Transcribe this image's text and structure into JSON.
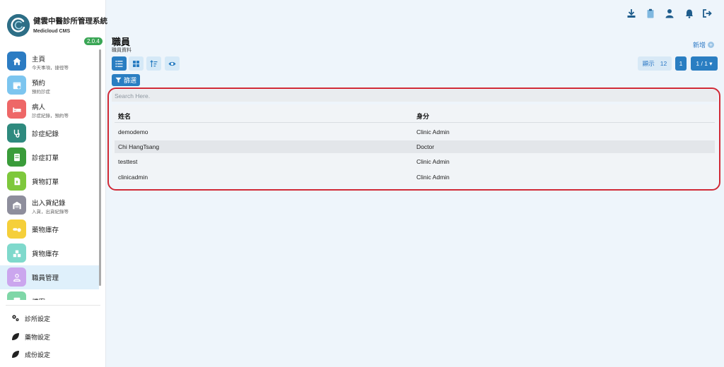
{
  "brand": {
    "title": "健雲中醫診所管理系統",
    "subtitle": "Medicloud CMS",
    "version": "2.0.4"
  },
  "nav": {
    "items": [
      {
        "label": "主頁",
        "sub": "今天事項，捷徑等",
        "color": "#2c7cc3",
        "icon": "home-icon"
      },
      {
        "label": "預約",
        "sub": "預約診症",
        "color": "#7cc5ef",
        "icon": "calendar-icon"
      },
      {
        "label": "病人",
        "sub": "診症紀錄，預約等",
        "color": "#ee6767",
        "icon": "bed-icon"
      },
      {
        "label": "診症紀錄",
        "sub": "",
        "color": "#2e8a7e",
        "icon": "stethoscope-icon"
      },
      {
        "label": "診症訂單",
        "sub": "",
        "color": "#3a9c3a",
        "icon": "order-icon"
      },
      {
        "label": "貨物訂單",
        "sub": "",
        "color": "#7ec83c",
        "icon": "document-icon"
      },
      {
        "label": "出入貨紀錄",
        "sub": "入貨，出貨紀錄等",
        "color": "#8e8e9c",
        "icon": "warehouse-icon"
      },
      {
        "label": "藥物庫存",
        "sub": "",
        "color": "#f5cf3a",
        "icon": "pills-icon"
      },
      {
        "label": "貨物庫存",
        "sub": "",
        "color": "#7fd9cc",
        "icon": "boxes-icon"
      },
      {
        "label": "職員管理",
        "sub": "",
        "color": "#cba6ee",
        "icon": "staff-icon"
      },
      {
        "label": "檔案",
        "sub": "",
        "color": "#7fd7a7",
        "icon": "file-icon"
      }
    ]
  },
  "settings": {
    "items": [
      {
        "label": "診所設定",
        "icon": "gears-icon"
      },
      {
        "label": "藥物設定",
        "icon": "leaf-icon"
      },
      {
        "label": "成份設定",
        "icon": "leaf-icon"
      }
    ]
  },
  "topbar": {
    "icons": [
      "download-icon",
      "clipboard-icon",
      "user-icon",
      "bell-icon",
      "logout-icon"
    ]
  },
  "page": {
    "title": "職員",
    "subtitle": "職員資料",
    "add_label": "新增",
    "add_plus": "+"
  },
  "toolbar": {
    "show_label": "顯示",
    "show_count": "12",
    "current_page": "1",
    "page_select": "1 / 1 ▾",
    "filter_label": "篩選"
  },
  "search": {
    "placeholder": "Search Here."
  },
  "table": {
    "columns": [
      "姓名",
      "身分"
    ],
    "rows": [
      [
        "demodemo",
        "Clinic Admin"
      ],
      [
        "Chi HangTsang",
        "Doctor"
      ],
      [
        "testtest",
        "Clinic Admin"
      ],
      [
        "clinicadmin",
        "Clinic Admin"
      ]
    ]
  },
  "colors": {
    "accent": "#2a7ec2",
    "highlight_border": "#d12a36"
  }
}
